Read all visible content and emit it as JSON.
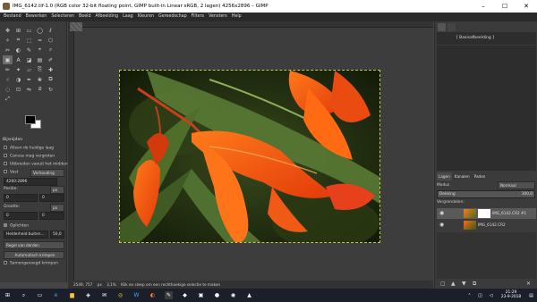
{
  "window": {
    "title": "IMG_6142.tif-1.0 (RGB color 32-bit floating point, GIMP built-in Linear sRGB, 2 lagen) 4256x2896 – GIMP",
    "controls": {
      "minimize": "–",
      "maximize": "☐",
      "close": "✕"
    }
  },
  "menubar": [
    "Bestand",
    "Bewerken",
    "Selecteren",
    "Beeld",
    "Afbeelding",
    "Laag",
    "Kleuren",
    "Gereedschap",
    "Filters",
    "Vensters",
    "Help"
  ],
  "toolbox": {
    "tool_icons": [
      "move-tool-icon",
      "align-tool-icon",
      "rect-select-icon",
      "ellipse-select-icon",
      "lasso-icon",
      "fuzzy-select-icon",
      "crop-icon",
      "unified-transform-icon",
      "warp-icon",
      "cage-icon",
      "scissors-icon",
      "foreground-select-icon",
      "paths-icon",
      "color-picker-icon",
      "zoom-icon",
      "measure-icon",
      "text-icon",
      "fill-icon",
      "gradient-icon",
      "paintbrush-icon",
      "pencil-icon",
      "airbrush-icon",
      "eraser-icon",
      "clone-icon",
      "heal-icon",
      "smudge-icon",
      "dodge-icon",
      "ink-icon",
      "mypaint-icon",
      "perspective-clone-icon",
      "blur-icon",
      "handle-transform-icon",
      "flip-icon",
      "shear-icon",
      "rotate-icon",
      "scale-icon"
    ],
    "colors": {
      "foreground": "#000000",
      "background": "#ffffff"
    },
    "options_title": "Bijsnijden",
    "opt_current_layer": "Alleen de huidige laag",
    "opt_delete_pixels": "Canvas mag vergroten",
    "opt_expand_from_center": "Uitbreiden vanuit het midden",
    "fixed_label": "Vast",
    "fixed_value": "Verhouding",
    "ratio_value": "4260:2896",
    "position_label": "Positie:",
    "position_unit": "px",
    "pos_x": "0",
    "pos_y": "0",
    "size_label": "Grootte:",
    "size_unit": "px",
    "size_w": "0",
    "size_h": "0",
    "highlight_label": "Oplichten",
    "highlight_value": "Helderheid buiten...",
    "highlight_num": "50,0",
    "guides_value": "Regel van derden",
    "auto_shrink": "Automatisch krimpen",
    "shrink_merged": "Samengevoegd krimpen"
  },
  "canvas": {
    "status_coords": "2549, 757",
    "status_unit": "px",
    "status_zoom": "3,1%",
    "status_message": "Klik en sleep om een rechthoekige selectie te maken"
  },
  "rightdock": {
    "histogram_label": "[ Basisafbeelding ]",
    "tabs": [
      "Lagen",
      "Kanalen",
      "Paden"
    ],
    "mode_label": "Modus",
    "mode_value": "Normaal",
    "opacity_label": "Dekking",
    "opacity_value": "100,0",
    "lock_label": "Vergrendelen:",
    "layers": [
      {
        "name": "IMG_6142.CR2 #1"
      },
      {
        "name": "IMG_6142.CR2"
      }
    ]
  },
  "taskbar": {
    "search_icon": "search-icon",
    "time": "21:29",
    "date": "23-9-2018"
  }
}
